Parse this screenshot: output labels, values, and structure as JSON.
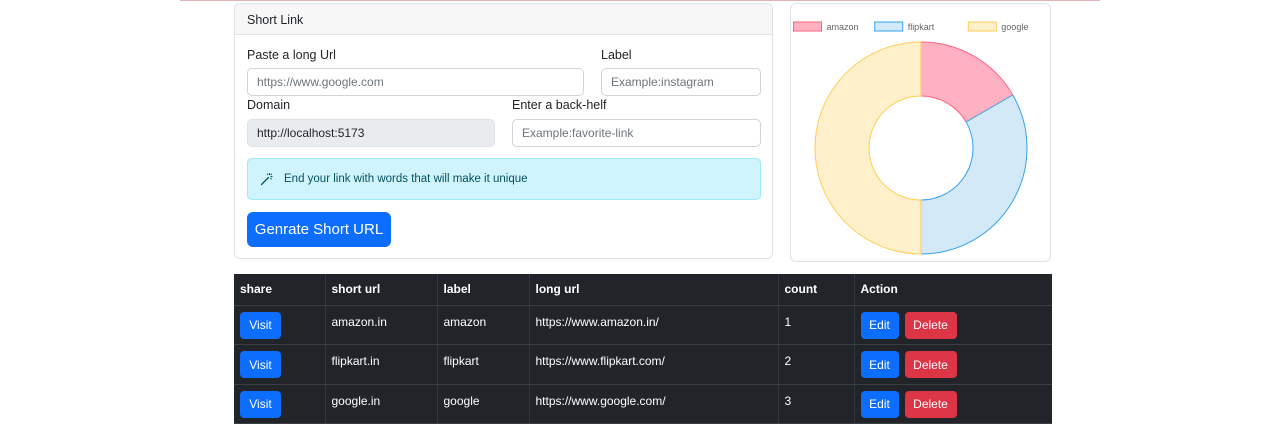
{
  "form": {
    "header": "Short Link",
    "long_url_label": "Paste a long Url",
    "long_url_placeholder": "https://www.google.com",
    "label_label": "Label",
    "label_placeholder": "Example:instagram",
    "domain_label": "Domain",
    "domain_value": "http://localhost:5173",
    "backhalf_label": "Enter a back-helf",
    "backhalf_placeholder": "Example:favorite-link",
    "alert_icon": "magic-wand-icon",
    "alert_text": "End your link with words that will make it unique",
    "submit_label": "Genrate Short URL"
  },
  "chart_data": {
    "type": "pie",
    "variant": "doughnut",
    "categories": [
      "amazon",
      "flipkart",
      "google"
    ],
    "values": [
      1,
      2,
      3
    ],
    "legend_position": "top",
    "colors": {
      "fill": [
        "#ffb1c1",
        "#d3e9f8",
        "#fff0cc"
      ],
      "border": [
        "#ff6384",
        "#36a2eb",
        "#ffcd56"
      ]
    }
  },
  "table": {
    "headers": [
      "share",
      "short url",
      "label",
      "long url",
      "count",
      "Action"
    ],
    "rows": [
      {
        "share": "Visit",
        "short_url": "amazon.in",
        "label": "amazon",
        "long_url": "https://www.amazon.in/",
        "count": "1",
        "edit": "Edit",
        "delete": "Delete"
      },
      {
        "share": "Visit",
        "short_url": "flipkart.in",
        "label": "flipkart",
        "long_url": "https://www.flipkart.com/",
        "count": "2",
        "edit": "Edit",
        "delete": "Delete"
      },
      {
        "share": "Visit",
        "short_url": "google.in",
        "label": "google",
        "long_url": "https://www.google.com/",
        "count": "3",
        "edit": "Edit",
        "delete": "Delete"
      }
    ]
  },
  "colors": {
    "primary": "#0d6efd",
    "danger": "#dc3545",
    "info_bg": "#cff4fc",
    "table_dark": "#212529"
  }
}
